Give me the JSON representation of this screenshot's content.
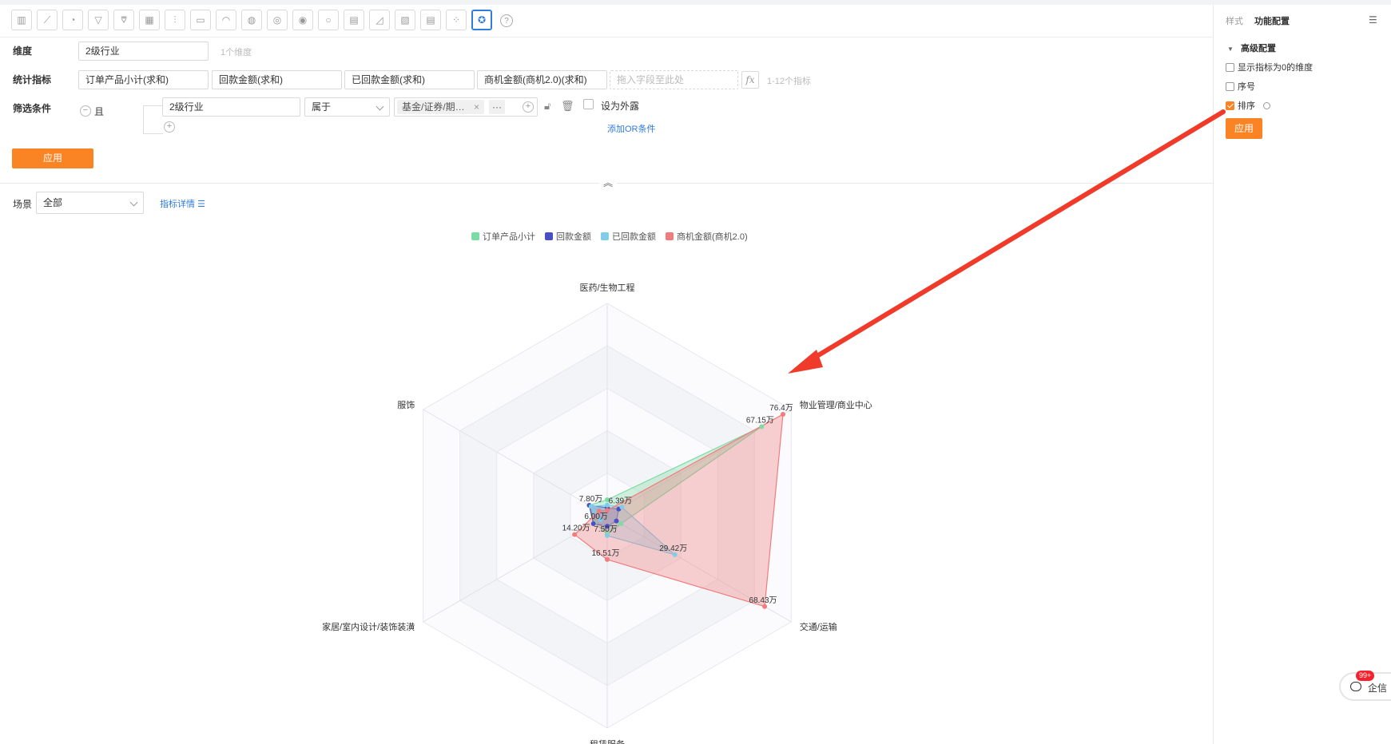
{
  "toolbar": {
    "icons": [
      "bar-chart-icon",
      "line-chart-icon",
      "pie-chart-icon",
      "funnel-icon",
      "funnel-alt-icon",
      "table-icon",
      "combo-chart-icon",
      "card-icon",
      "gauge-icon",
      "map-icon",
      "globe-icon",
      "globe-alt-icon",
      "bubble-icon",
      "column-icon",
      "area-icon",
      "heatmap-icon",
      "pivot-table-icon",
      "scatter-icon",
      "radar-icon"
    ],
    "active_icon": "radar-icon"
  },
  "form": {
    "dimension_label": "维度",
    "dimension_value": "2级行业",
    "dimension_hint": "1个维度",
    "metrics_label": "统计指标",
    "metrics": [
      "订单产品小计(求和)",
      "回款金额(求和)",
      "已回款金额(求和)",
      "商机金额(商机2.0)(求和)"
    ],
    "metrics_placeholder": "拖入字段至此处",
    "metrics_hint": "1-12个指标",
    "filter_label": "筛选条件",
    "filter_logic": "且",
    "filter_field": "2级行业",
    "filter_operator": "属于",
    "filter_tag": "基金/证券/期…",
    "filter_more": "···",
    "expose_label": "设为外露",
    "add_or_label": "添加OR条件",
    "apply_label": "应用"
  },
  "scene": {
    "label": "场景",
    "value": "全部",
    "detail_link": "指标详情"
  },
  "panel": {
    "tab_style": "样式",
    "tab_function": "功能配置",
    "section_title": "高级配置",
    "opt_show_zero": "显示指标为0的维度",
    "opt_index": "序号",
    "opt_sort": "排序",
    "apply_label": "应用"
  },
  "float": {
    "label": "企信",
    "badge": "99+"
  },
  "colors": {
    "accent": "#fa8424",
    "link": "#2f7bde",
    "annotation_arrow": "#f03a2a"
  },
  "chart_data": {
    "type": "radar",
    "indicators": [
      "医药/生物工程",
      "物业管理/商业中心",
      "交通/运输",
      "租赁服务",
      "家居/室内设计/装饰装潢",
      "服饰"
    ],
    "max": 80,
    "series": [
      {
        "name": "订单产品小计",
        "color": "#7ddba3",
        "values": [
          6.0,
          67.15,
          6.0,
          7.0,
          5.5,
          7.8
        ]
      },
      {
        "name": "回款金额",
        "color": "#4a4fc4",
        "values": [
          3.0,
          5.0,
          4.0,
          4.0,
          6.0,
          7.8
        ]
      },
      {
        "name": "已回款金额",
        "color": "#7fcde9",
        "values": [
          4.0,
          6.39,
          29.42,
          7.5,
          3.0,
          7.0
        ]
      },
      {
        "name": "商机金额(商机2.0)",
        "color": "#f27b7b",
        "values": [
          2.0,
          76.4,
          68.43,
          16.51,
          14.2,
          3.5
        ]
      }
    ],
    "data_labels": [
      {
        "text": "76.4万",
        "series": 3,
        "index": 1
      },
      {
        "text": "67.15万",
        "series": 0,
        "index": 1
      },
      {
        "text": "7.80万",
        "series": 0,
        "index": 5
      },
      {
        "text": "6.39万",
        "series": 2,
        "index": 1
      },
      {
        "text": "6.00万",
        "series": 0,
        "index": 4
      },
      {
        "text": "14.20万",
        "series": 3,
        "index": 4
      },
      {
        "text": "7.50万",
        "series": 2,
        "index": 3
      },
      {
        "text": "16.51万",
        "series": 3,
        "index": 3
      },
      {
        "text": "29.42万",
        "series": 2,
        "index": 2
      },
      {
        "text": "68.43万",
        "series": 3,
        "index": 2
      }
    ],
    "legend_position": "top"
  }
}
